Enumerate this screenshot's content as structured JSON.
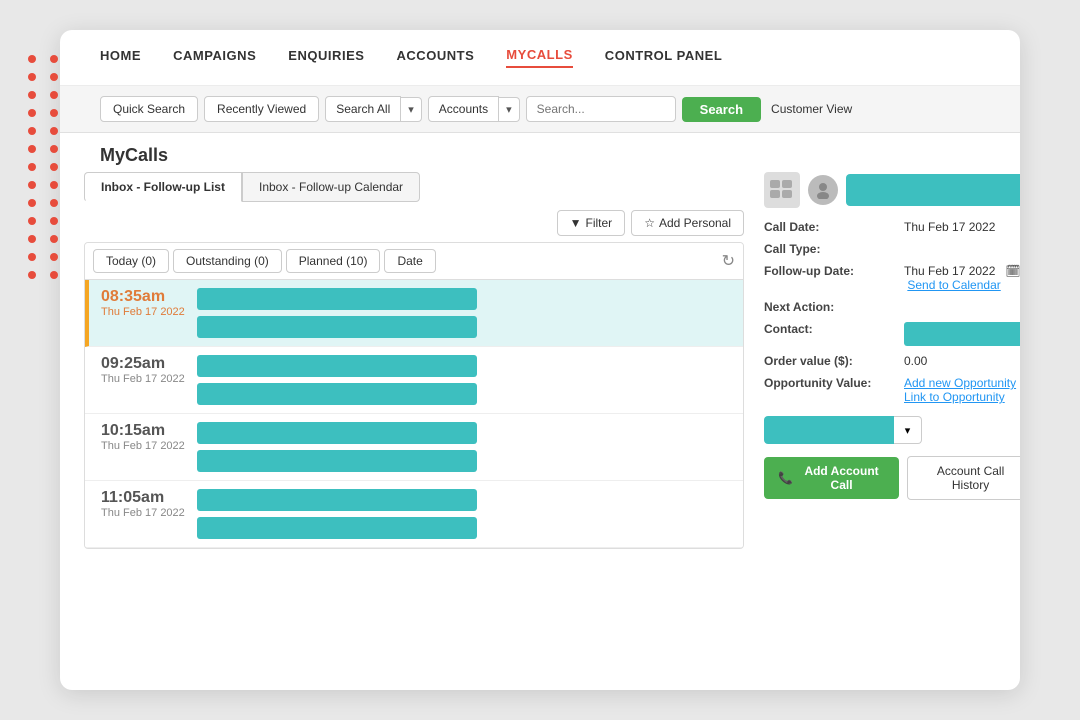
{
  "nav": {
    "items": [
      {
        "label": "HOME",
        "active": false
      },
      {
        "label": "CAMPAIGNS",
        "active": false
      },
      {
        "label": "ENQUIRIES",
        "active": false
      },
      {
        "label": "ACCOUNTS",
        "active": false
      },
      {
        "label": "MYCALLS",
        "active": true
      },
      {
        "label": "CONTROL PANEL",
        "active": false
      }
    ]
  },
  "toolbar": {
    "quick_search": "Quick Search",
    "recently_viewed": "Recently Viewed",
    "search_all": "Search All",
    "accounts": "Accounts",
    "search_placeholder": "Search...",
    "search_btn": "Search",
    "customer_view": "Customer View"
  },
  "page_title": "MyCalls",
  "tabs": {
    "tab1": "Inbox - Follow-up List",
    "tab2": "Inbox - Follow-up Calendar"
  },
  "panel_actions": {
    "filter": "Filter",
    "add_personal": "Add Personal"
  },
  "sub_tabs": {
    "today": "Today (0)",
    "outstanding": "Outstanding (0)",
    "planned": "Planned (10)",
    "date": "Date"
  },
  "time_entries": [
    {
      "time": "08:35am",
      "date": "Thu Feb 17 2022",
      "selected": true
    },
    {
      "time": "09:25am",
      "date": "Thu Feb 17 2022",
      "selected": false
    },
    {
      "time": "10:15am",
      "date": "Thu Feb 17 2022",
      "selected": false
    },
    {
      "time": "11:05am",
      "date": "Thu Feb 17 2022",
      "selected": false
    }
  ],
  "detail": {
    "call_date_label": "Call Date:",
    "call_date_value": "Thu Feb 17 2022",
    "call_type_label": "Call Type:",
    "call_type_value": "",
    "followup_date_label": "Follow-up Date:",
    "followup_date_value": "Thu Feb 17 2022",
    "send_to_calendar": "Send to Calendar",
    "next_action_label": "Next Action:",
    "next_action_value": "",
    "contact_label": "Contact:",
    "order_value_label": "Order value ($):",
    "order_value": "0.00",
    "opportunity_label": "Opportunity Value:",
    "add_new_opp": "Add new Opportunity",
    "link_to_opp": "Link to Opportunity",
    "add_call_btn": "Add Account Call",
    "call_history_btn": "Account Call History"
  },
  "icons": {
    "filter": "▼",
    "person": "👤",
    "face": "😐",
    "phone": "📞",
    "calendar": "🗓",
    "refresh": "↻",
    "chevron_down": "▾"
  }
}
